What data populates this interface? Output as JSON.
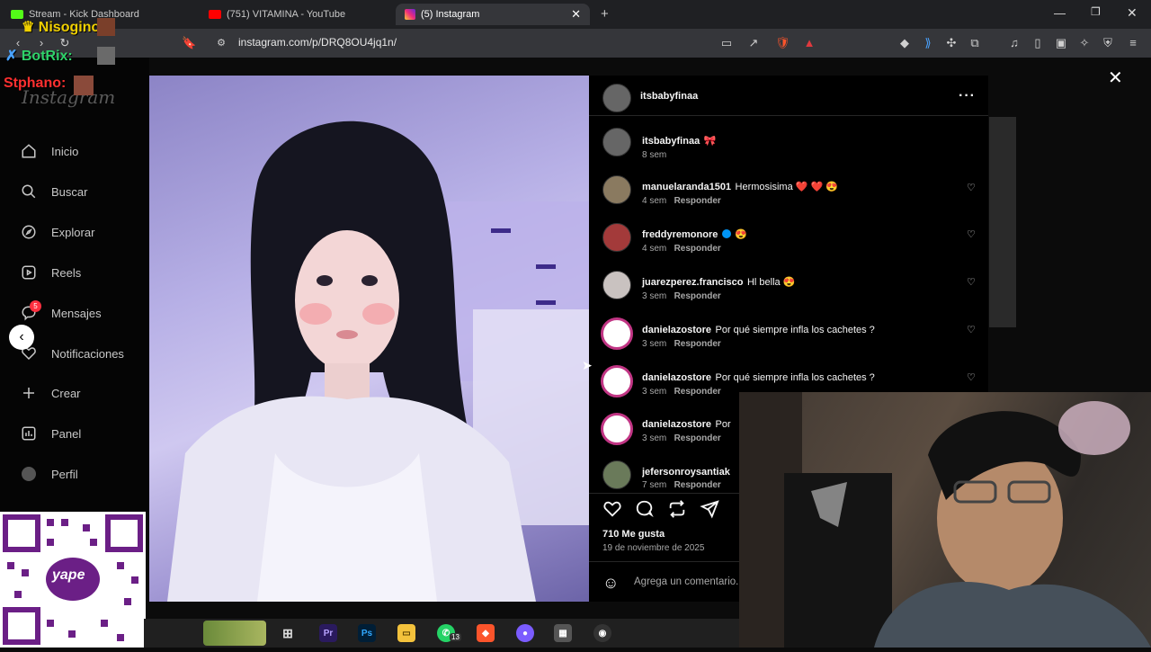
{
  "tabs": [
    {
      "label": "Stream - Kick Dashboard",
      "active": false
    },
    {
      "label": "(751) VITAMINA - YouTube",
      "active": false
    },
    {
      "label": "(5) Instagram",
      "active": true
    }
  ],
  "address": {
    "url": "instagram.com/p/DRQ8OU4jq1n/"
  },
  "chat_overlay": [
    {
      "name": "Nisogino:",
      "color": "#f0d000"
    },
    {
      "name": "BotRix:",
      "color": "#2fd36a"
    },
    {
      "name": "Stphano:",
      "color": "#ff3030"
    }
  ],
  "brand": "Instagram",
  "sidebar": {
    "items": [
      {
        "label": "Inicio",
        "icon": "home-icon"
      },
      {
        "label": "Buscar",
        "icon": "search-icon"
      },
      {
        "label": "Explorar",
        "icon": "compass-icon"
      },
      {
        "label": "Reels",
        "icon": "reels-icon"
      },
      {
        "label": "Mensajes",
        "icon": "messenger-icon",
        "badge": "5"
      },
      {
        "label": "Notificaciones",
        "icon": "heart-icon"
      },
      {
        "label": "Crear",
        "icon": "plus-icon"
      },
      {
        "label": "Panel",
        "icon": "chart-icon"
      },
      {
        "label": "Perfil",
        "icon": "avatar-icon"
      }
    ]
  },
  "post": {
    "author": "itsbabyfinaa",
    "caption_user": "itsbabyfinaa",
    "caption_emoji": "🎀",
    "caption_time": "8 sem",
    "likes": "710 Me gusta",
    "date": "19 de noviembre de 2025",
    "comment_placeholder": "Agrega un comentario..."
  },
  "comments": [
    {
      "user": "manuelaranda1501",
      "text": "Hermosisima ❤️ ❤️ 😍",
      "time": "4 sem",
      "reply": "Responder"
    },
    {
      "user": "freddyremonore",
      "text": "😍",
      "time": "4 sem",
      "reply": "Responder",
      "verified": true
    },
    {
      "user": "juarezperez.francisco",
      "text": "Hl bella 😍",
      "time": "3 sem",
      "reply": "Responder"
    },
    {
      "user": "danielazostore",
      "text": "Por qué siempre infla los cachetes ?",
      "time": "3 sem",
      "reply": "Responder"
    },
    {
      "user": "danielazostore",
      "text": "Por qué siempre infla los cachetes ?",
      "time": "3 sem",
      "reply": "Responder"
    },
    {
      "user": "danielazostore",
      "text": "Por",
      "time": "3 sem",
      "reply": "Responder"
    },
    {
      "user": "jefersonroysantiak",
      "text": "",
      "time": "7 sem",
      "reply": "Responder"
    }
  ],
  "yape": "yape",
  "colors": {
    "accent": "#0095f6",
    "heart": "#ff3040",
    "panel": "#000000"
  }
}
